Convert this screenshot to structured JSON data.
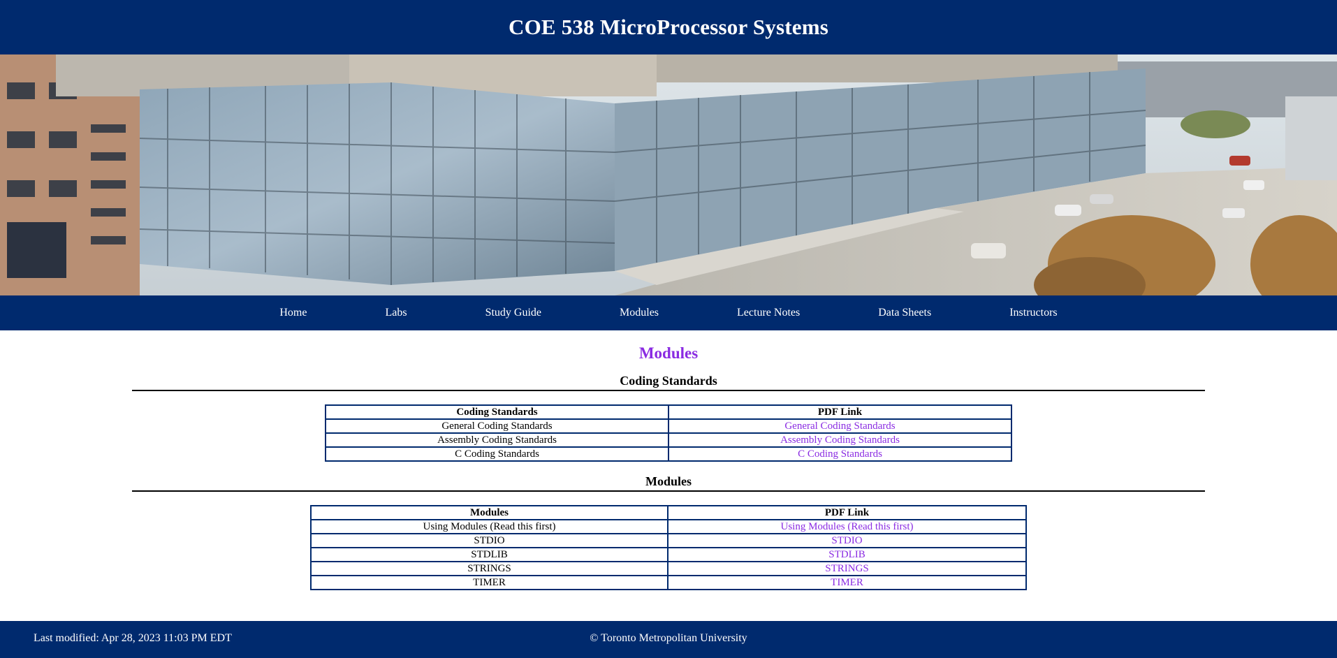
{
  "header": {
    "title": "COE 538 MicroProcessor Systems"
  },
  "nav": {
    "items": [
      "Home",
      "Labs",
      "Study Guide",
      "Modules",
      "Lecture Notes",
      "Data Sheets",
      "Instructors"
    ]
  },
  "main": {
    "title": "Modules",
    "coding_standards": {
      "heading": "Coding Standards",
      "columns": [
        "Coding Standards",
        "PDF Link"
      ],
      "rows": [
        [
          "General Coding Standards",
          "General Coding Standards"
        ],
        [
          "Assembly Coding Standards",
          "Assembly Coding Standards"
        ],
        [
          "C Coding Standards",
          "C Coding Standards"
        ]
      ]
    },
    "modules": {
      "heading": "Modules",
      "columns": [
        "Modules",
        "PDF Link"
      ],
      "rows": [
        [
          "Using Modules (Read this first)",
          "Using Modules (Read this first)"
        ],
        [
          "STDIO",
          "STDIO"
        ],
        [
          "STDLIB",
          "STDLIB"
        ],
        [
          "STRINGS",
          "STRINGS"
        ],
        [
          "TIMER",
          "TIMER"
        ]
      ]
    }
  },
  "footer": {
    "modified": "Last modified: Apr 28, 2023 11:03 PM EDT",
    "copyright": "© Toronto Metropolitan University"
  },
  "colors": {
    "brand_navy": "#002a6e",
    "link_purple": "#8a2be2"
  },
  "hero": {
    "image": "glass-building-street-photo"
  }
}
